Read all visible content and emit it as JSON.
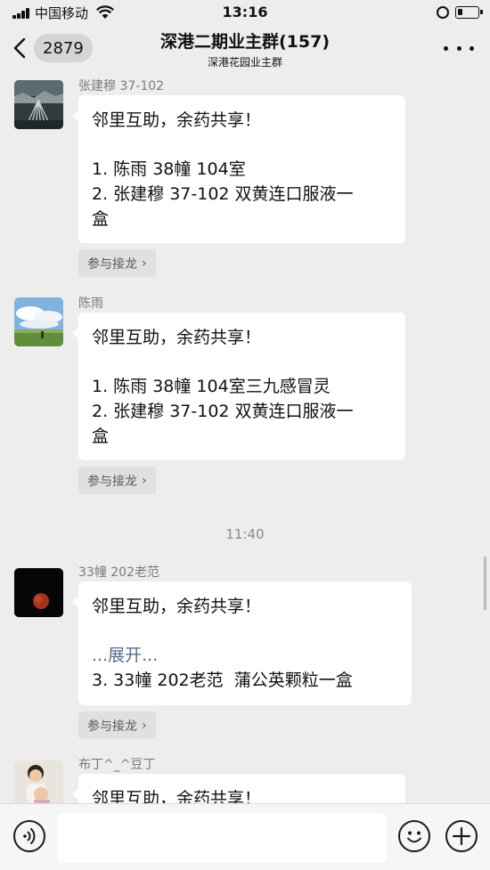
{
  "status_bar": {
    "carrier": "中国移动",
    "time": "13:16"
  },
  "nav": {
    "unread_count": "2879",
    "title": "深港二期业主群(157)",
    "subtitle": "深港花园业主群"
  },
  "messages": [
    {
      "sender": "张建穆 37-102",
      "avatar": "avatar-landscape-aerial",
      "lines": [
        "邻里互助，余药共享！",
        "",
        "1. 陈雨 38幢 104室",
        "2. 张建穆 37-102 双黄连口服液一",
        "盒"
      ],
      "join_label": "参与接龙"
    },
    {
      "sender": "陈雨",
      "avatar": "avatar-sky-field",
      "lines": [
        "邻里互助，余药共享！",
        "",
        "1. 陈雨 38幢 104室三九感冒灵",
        "2. 张建穆 37-102 双黄连口服液一",
        "盒"
      ],
      "join_label": "参与接龙"
    },
    {
      "time_divider": "11:40"
    },
    {
      "sender": "33幢 202老范",
      "avatar": "avatar-moon-dark",
      "line1": "邻里互助，余药共享！",
      "expand": "...展开...",
      "line3": "3. 33幢 202老范  蒲公英颗粒一盒",
      "join_label": "参与接龙"
    },
    {
      "sender": "布丁^_^豆丁",
      "avatar": "avatar-child-photo",
      "line1": "邻里互助，余药共享！"
    }
  ],
  "input_bar": {
    "voice_icon": "voice-icon",
    "emoji_icon": "emoji-icon",
    "plus_icon": "plus-icon"
  }
}
